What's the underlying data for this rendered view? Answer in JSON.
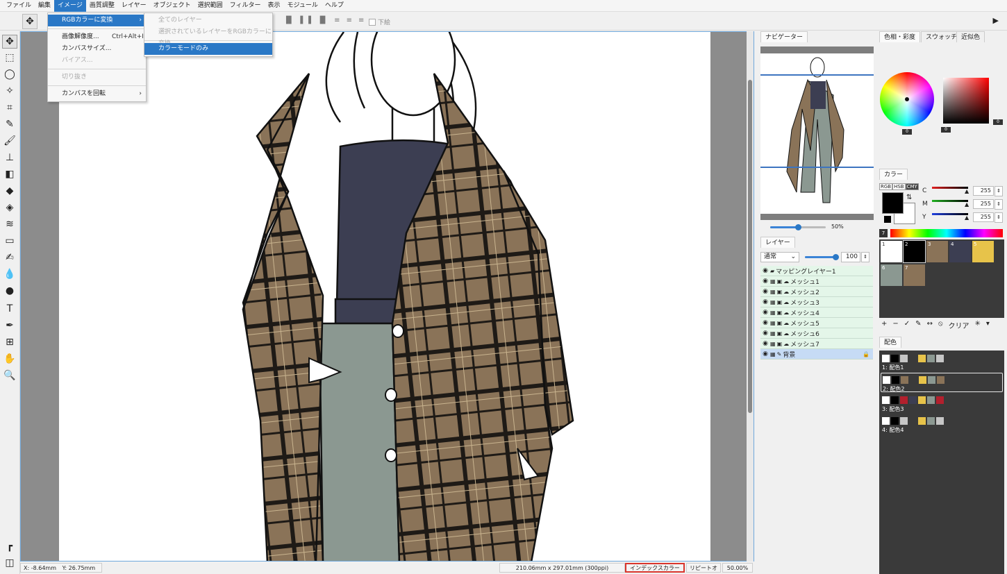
{
  "menubar": {
    "items": [
      "ファイル",
      "編集",
      "イメージ",
      "画質調整",
      "レイヤー",
      "オブジェクト",
      "選択範囲",
      "フィルター",
      "表示",
      "モジュール",
      "ヘルプ"
    ],
    "active_index": 2
  },
  "image_menu": {
    "items": [
      {
        "label": "RGBカラーに変換",
        "shortcut": "",
        "has_submenu": true,
        "highlighted": true,
        "disabled": false
      },
      {
        "label": "画像解像度...",
        "shortcut": "Ctrl+Alt+I",
        "has_submenu": false,
        "highlighted": false,
        "disabled": false
      },
      {
        "label": "カンバスサイズ...",
        "shortcut": "",
        "has_submenu": false,
        "highlighted": false,
        "disabled": false
      },
      {
        "label": "バイアス...",
        "shortcut": "",
        "has_submenu": false,
        "highlighted": false,
        "disabled": true
      },
      {
        "label": "切り抜き",
        "shortcut": "",
        "has_submenu": false,
        "highlighted": false,
        "disabled": true
      },
      {
        "label": "カンバスを回転",
        "shortcut": "",
        "has_submenu": true,
        "highlighted": false,
        "disabled": false
      }
    ]
  },
  "rgb_submenu": {
    "items": [
      {
        "label": "全てのレイヤー",
        "disabled": true,
        "highlighted": false
      },
      {
        "label": "選択されているレイヤーをRGBカラーに変換",
        "disabled": true,
        "highlighted": false
      },
      {
        "label": "カラーモードのみ",
        "disabled": false,
        "highlighted": true
      }
    ]
  },
  "options_bar": {
    "checkbox_label": "下絵",
    "checked": false
  },
  "toolbox": {
    "tools": [
      "move-icon",
      "rect-select-icon",
      "lasso-icon",
      "magic-wand-icon",
      "crop-icon",
      "eyedropper-icon",
      "brush-icon",
      "stamp-icon",
      "eraser-icon",
      "fill-icon",
      "gradient-fill-icon",
      "pattern-icon",
      "rectangle-icon",
      "pen-tool-icon",
      "blur-icon",
      "dodge-icon",
      "text-icon",
      "vector-pen-icon",
      "mesh-icon",
      "hand-icon",
      "zoom-icon",
      "ruler-icon",
      "snap-icon"
    ]
  },
  "statusbar": {
    "x_label": "X:",
    "x_value": "-8.64mm",
    "y_label": "Y:",
    "y_value": "26.75mm",
    "doc_size": "210.06mm x 297.01mm (300ppi)",
    "color_mode": "インデックスカラー",
    "repeat": "リピートオフ",
    "zoom": "50.00%"
  },
  "navigator": {
    "tab": "ナビゲーター",
    "zoom": "50%",
    "zoom_fraction": 0.5
  },
  "layers_panel": {
    "tab": "レイヤー",
    "blend_mode": "通常",
    "opacity": "100",
    "opacity_fraction": 1.0,
    "layers": [
      {
        "name": "マッピングレイヤー1",
        "kind": "folder",
        "selected": false,
        "locked": false
      },
      {
        "name": "メッシュ1",
        "kind": "mesh",
        "selected": false,
        "locked": false
      },
      {
        "name": "メッシュ2",
        "kind": "mesh",
        "selected": false,
        "locked": false
      },
      {
        "name": "メッシュ3",
        "kind": "mesh",
        "selected": false,
        "locked": false
      },
      {
        "name": "メッシュ4",
        "kind": "mesh",
        "selected": false,
        "locked": false
      },
      {
        "name": "メッシュ5",
        "kind": "mesh",
        "selected": false,
        "locked": false
      },
      {
        "name": "メッシュ6",
        "kind": "mesh",
        "selected": false,
        "locked": false
      },
      {
        "name": "メッシュ7",
        "kind": "mesh",
        "selected": false,
        "locked": false
      },
      {
        "name": "背景",
        "kind": "background",
        "selected": true,
        "locked": true
      }
    ]
  },
  "color_tabs": [
    "色相・彩度",
    "スウォッチ",
    "近似色"
  ],
  "hue_panel": {
    "wheel_value": "0",
    "square_left_value": "0",
    "square_right_value": "0"
  },
  "color_panel": {
    "tab": "カラー",
    "modes": [
      "RGB",
      "HSB",
      "CMY"
    ],
    "active_mode": "CMY",
    "channels": [
      {
        "label": "C",
        "value": "255",
        "color": "#e02020"
      },
      {
        "label": "M",
        "value": "255",
        "color": "#20b020"
      },
      {
        "label": "Y",
        "value": "255",
        "color": "#2040e0"
      }
    ],
    "spectrum_badge": "7",
    "foreground": "#000000",
    "background": "#ffffff"
  },
  "palette": {
    "swatches": [
      {
        "index": "1",
        "color": "#ffffff"
      },
      {
        "index": "2",
        "color": "#000000"
      },
      {
        "index": "3",
        "color": "#8a7358"
      },
      {
        "index": "4",
        "color": "#3c3e52"
      },
      {
        "index": "5",
        "color": "#e7c34a"
      },
      {
        "index": "6",
        "color": "#8b9891"
      },
      {
        "index": "7",
        "color": "#8a7358"
      }
    ],
    "toolbar": [
      "+",
      "−",
      "✓",
      "✎",
      "↔",
      "⦸",
      "クリア",
      "✳",
      "▾"
    ]
  },
  "schemes": {
    "tab": "配色",
    "items": [
      {
        "label": "1: 配色1",
        "chips": [
          "#ffffff",
          "#000000",
          "#c6c6c6",
          "#3a3a3a",
          "#e7c34a",
          "#8b9891",
          "#c6c6c6"
        ],
        "selected": false
      },
      {
        "label": "2: 配色2",
        "chips": [
          "#ffffff",
          "#000000",
          "#8a7358",
          "#3a3a3a",
          "#e7c34a",
          "#8b9891",
          "#8a7358"
        ],
        "selected": true
      },
      {
        "label": "3: 配色3",
        "chips": [
          "#ffffff",
          "#000000",
          "#b3202d",
          "#3c3e52",
          "#e7c34a",
          "#8b9891",
          "#b3202d"
        ],
        "selected": false
      },
      {
        "label": "4: 配色4",
        "chips": [
          "#ffffff",
          "#000000",
          "#c6c6c6",
          "#3a3a3a",
          "#e7c34a",
          "#8b9891",
          "#c6c6c6"
        ],
        "selected": false
      }
    ]
  },
  "colors": {
    "accent": "#2a78c6",
    "highlight_border": "#d9352c",
    "coat": "#8a7358",
    "shirt": "#3c3e52",
    "pants": "#8b9891"
  }
}
